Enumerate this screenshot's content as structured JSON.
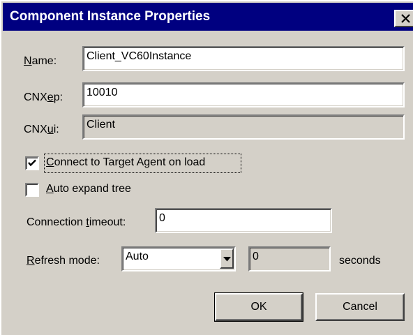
{
  "dialog": {
    "title": "Component Instance Properties",
    "close_icon": "close-icon"
  },
  "fields": {
    "name": {
      "label_u": "N",
      "label_rest": "ame:",
      "value": "Client_VC60Instance"
    },
    "cnxep": {
      "label_pre": "CNX",
      "label_u": "e",
      "label_rest": "p:",
      "value": "10010"
    },
    "cnxui": {
      "label_pre": "CNX",
      "label_u": "u",
      "label_rest": "i:",
      "value": "Client"
    }
  },
  "options": {
    "connect": {
      "label_u": "C",
      "label_rest": "onnect to Target Agent on load",
      "checked": true
    },
    "autoexpand": {
      "label_u": "A",
      "label_rest": "uto expand tree",
      "checked": false
    }
  },
  "timeout": {
    "label_pre": "Connection ",
    "label_u": "t",
    "label_rest": "imeout:",
    "value": "0"
  },
  "refresh": {
    "label_u": "R",
    "label_rest": "efresh mode:",
    "mode": "Auto",
    "interval": "0",
    "units": "seconds"
  },
  "buttons": {
    "ok": "OK",
    "cancel": "Cancel"
  },
  "colors": {
    "titlebar": "#000080",
    "face": "#d4d0c8"
  }
}
